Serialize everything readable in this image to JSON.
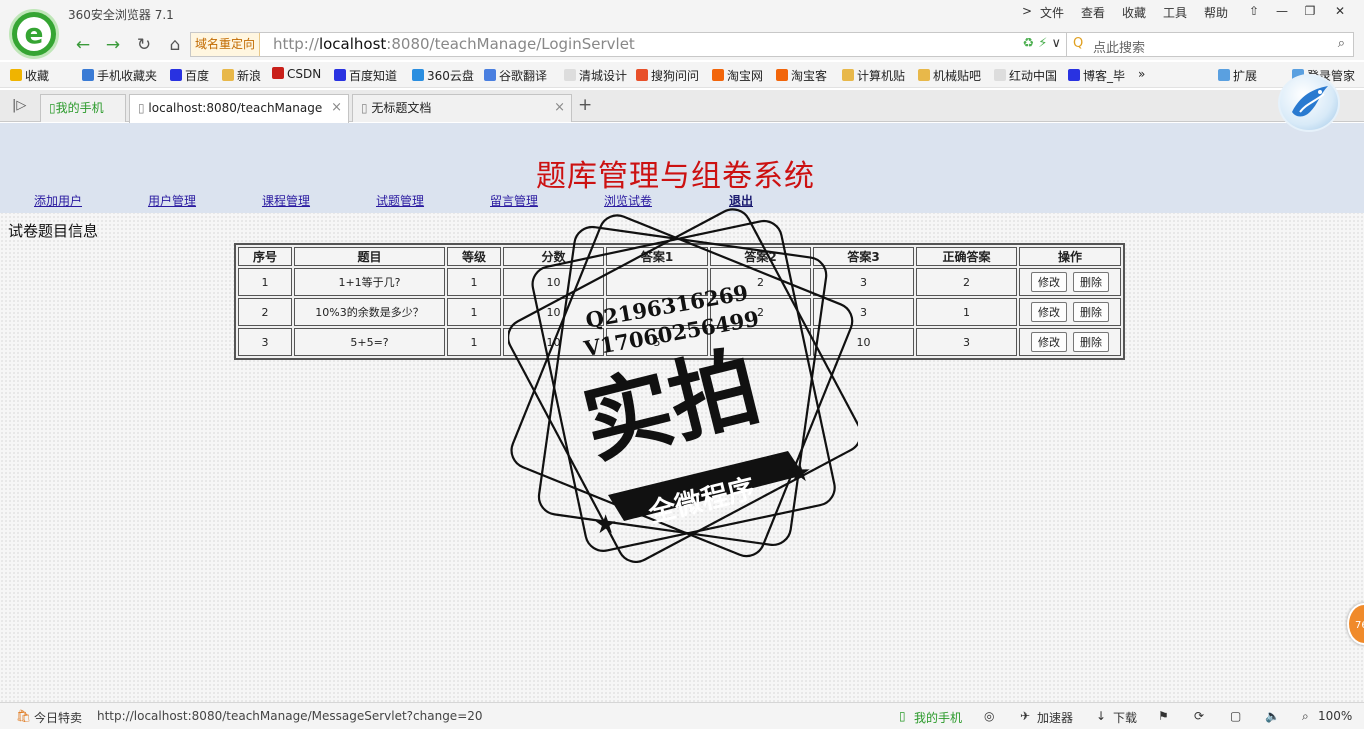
{
  "window": {
    "title": "360安全浏览器 7.1",
    "menus": [
      "文件",
      "查看",
      "收藏",
      "工具",
      "帮助"
    ],
    "menu_arrow": ">",
    "controls": [
      "⇧",
      "—",
      "❐",
      "✕"
    ]
  },
  "address_bar": {
    "redirect_label": "域名重定向",
    "url_prefix": "http://",
    "url_host": "localhost",
    "url_rest": ":8080/teachManage/LoginServlet",
    "search_placeholder": "点此搜索"
  },
  "bookmarks": [
    {
      "label": "收藏",
      "color": "#f0b400"
    },
    {
      "label": "手机收藏夹",
      "color": "#3a7bd5"
    },
    {
      "label": "百度",
      "color": "#2932e1"
    },
    {
      "label": "新浪",
      "color": "#e8b84a"
    },
    {
      "label": "CSDN",
      "color": "#c9201a"
    },
    {
      "label": "百度知道",
      "color": "#2932e1"
    },
    {
      "label": "360云盘",
      "color": "#2a8ee0"
    },
    {
      "label": "谷歌翻译",
      "color": "#4a7fe0"
    },
    {
      "label": "清城设计",
      "color": "#dddddd"
    },
    {
      "label": "搜狗问问",
      "color": "#e8502a"
    },
    {
      "label": "淘宝网",
      "color": "#f2650a"
    },
    {
      "label": "淘宝客",
      "color": "#f2650a"
    },
    {
      "label": "计算机贴",
      "color": "#e8b84a"
    },
    {
      "label": "机械贴吧",
      "color": "#e8b84a"
    },
    {
      "label": "红动中国",
      "color": "#dddddd"
    },
    {
      "label": "博客_毕",
      "color": "#2932e1"
    },
    {
      "label": "»",
      "color": ""
    },
    {
      "label": "扩展",
      "color": "#5aa0e0"
    },
    {
      "label": "登录管家",
      "color": "#5aa0e0"
    }
  ],
  "tabs": [
    {
      "label": "我的手机"
    },
    {
      "label": "localhost:8080/teachManage"
    },
    {
      "label": "无标题文档"
    }
  ],
  "page": {
    "site_title": "题库管理与组卷系统",
    "nav": [
      "添加用户",
      "用户管理",
      "课程管理",
      "试题管理",
      "留言管理",
      "浏览试卷",
      "退出"
    ],
    "section_title": "试卷题目信息",
    "table": {
      "headers": [
        "序号",
        "题目",
        "等级",
        "分数",
        "答案1",
        "答案2",
        "答案3",
        "正确答案",
        "操作"
      ],
      "rows": [
        [
          "1",
          "1+1等于几?",
          "1",
          "10",
          "",
          "2",
          "3",
          "2"
        ],
        [
          "2",
          "10%3的余数是多少？",
          "1",
          "10",
          "",
          "2",
          "3",
          "1"
        ],
        [
          "3",
          "5+5=?",
          "1",
          "10",
          "5",
          "",
          "10",
          "3"
        ]
      ],
      "edit_label": "修改",
      "delete_label": "删除"
    },
    "watermark": {
      "line1": "Q2196316269",
      "line2": "V17060256499",
      "big": "实拍",
      "ribbon": "全微程序"
    },
    "side_badge": "76"
  },
  "status_bar": {
    "deal": "今日特卖",
    "link_url": "http://localhost:8080/teachManage/MessageServlet?change=20",
    "phone": "我的手机",
    "accelerator": "加速器",
    "download": "下载",
    "zoom": "100%"
  }
}
